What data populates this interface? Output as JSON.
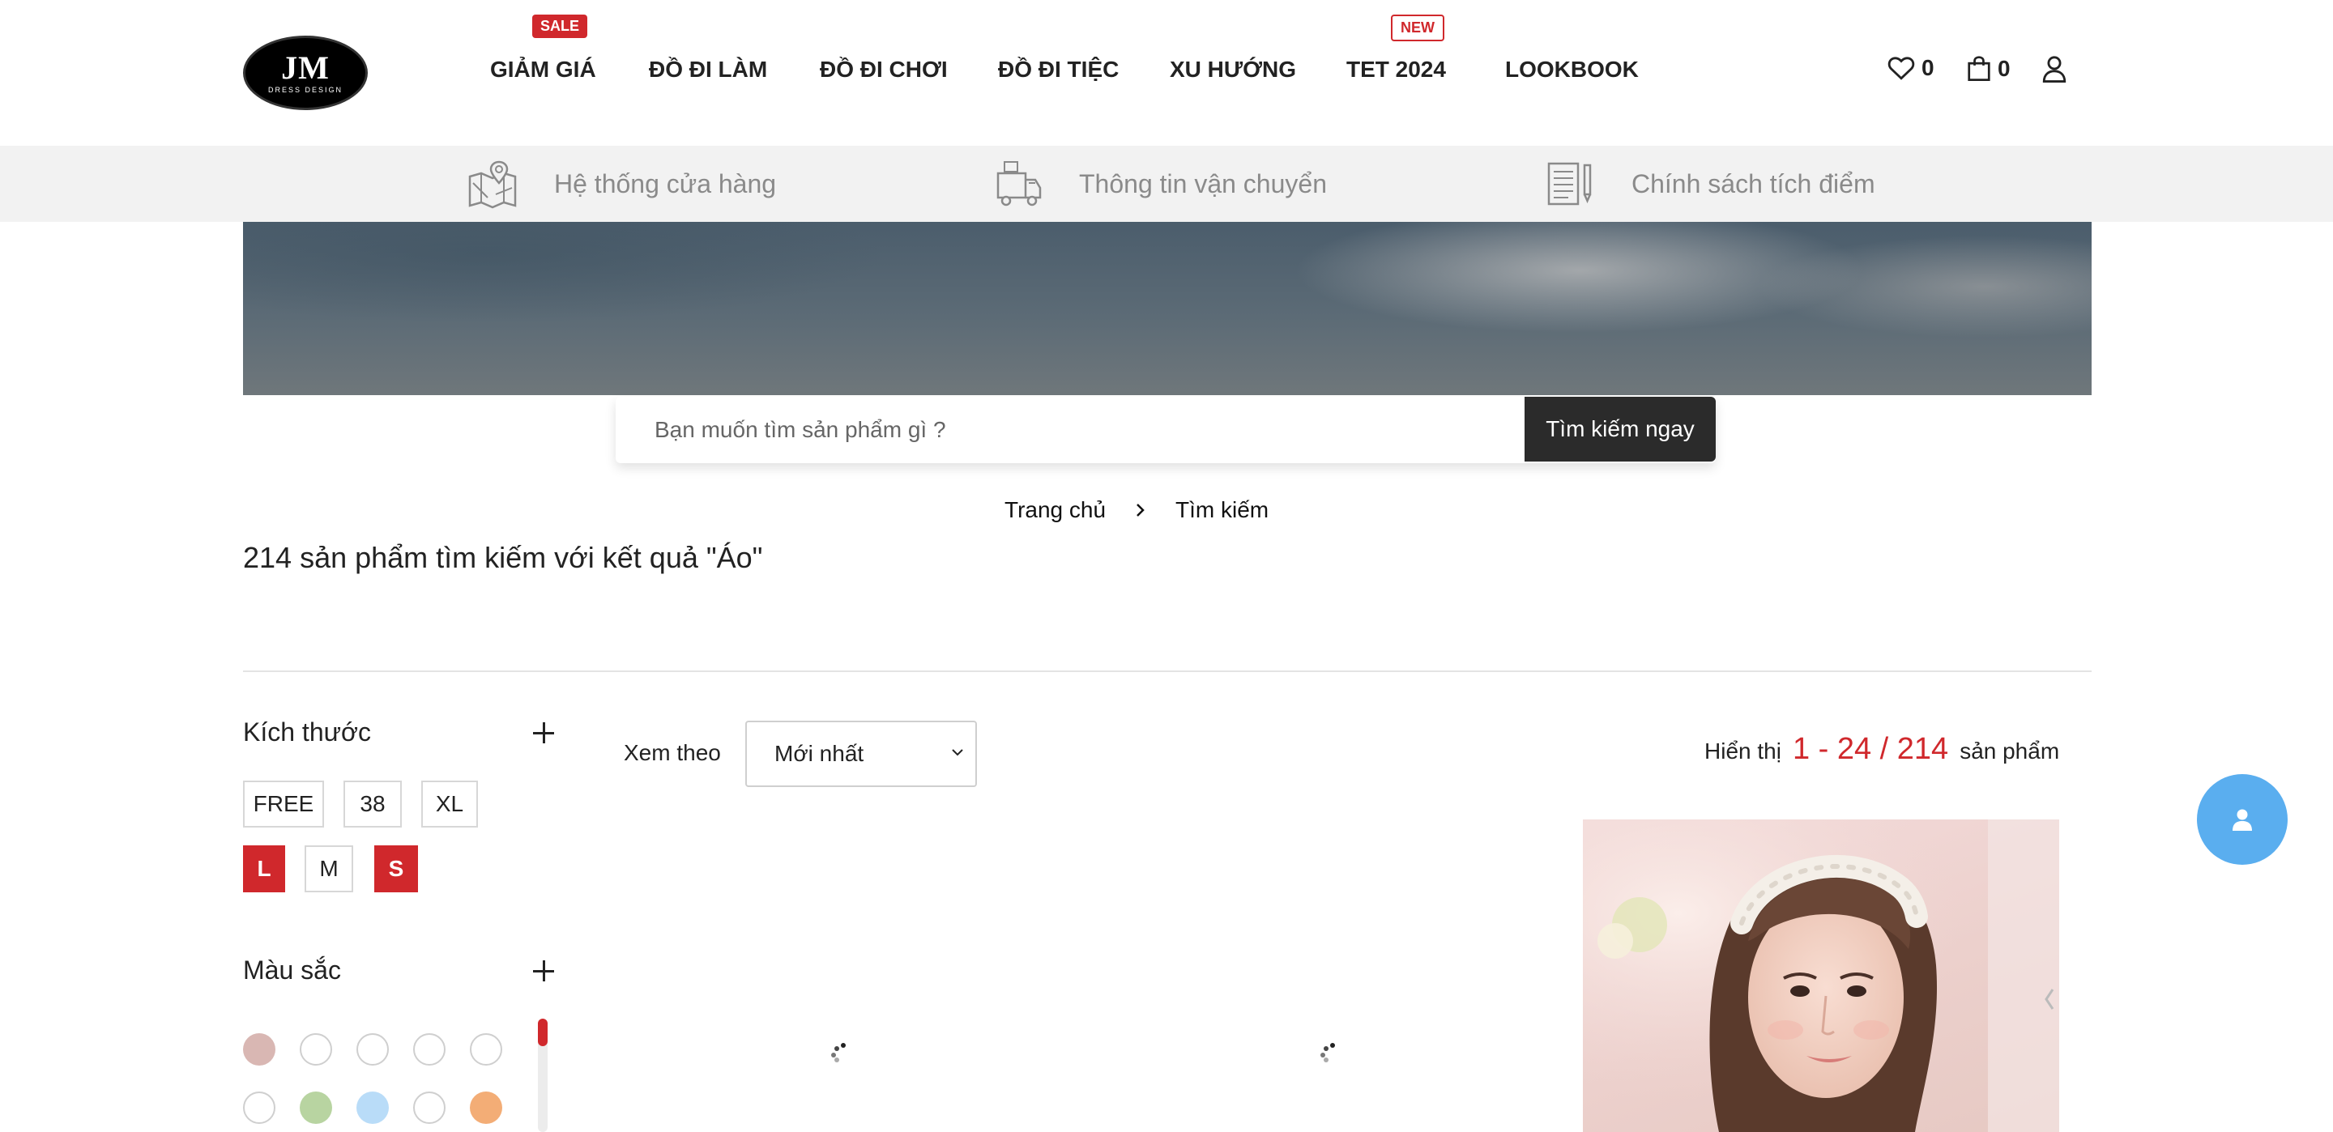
{
  "header": {
    "logo": {
      "main": "JM",
      "sub": "DRESS DESIGN"
    },
    "nav": [
      {
        "label": "GIẢM GIÁ",
        "badge": "SALE",
        "badge_type": "sale"
      },
      {
        "label": "ĐỒ ĐI LÀM"
      },
      {
        "label": "ĐỒ ĐI CHƠI"
      },
      {
        "label": "ĐỒ ĐI TIỆC"
      },
      {
        "label": "XU HƯỚNG"
      },
      {
        "label": "TET 2024",
        "badge": "NEW",
        "badge_type": "new"
      },
      {
        "label": "LOOKBOOK"
      }
    ],
    "wishlist_count": "0",
    "cart_count": "0"
  },
  "infobar": {
    "items": [
      {
        "label": "Hệ thống cửa hàng",
        "icon": "store-map-icon"
      },
      {
        "label": "Thông tin vận chuyển",
        "icon": "delivery-truck-icon"
      },
      {
        "label": "Chính sách tích điểm",
        "icon": "policy-document-icon"
      }
    ]
  },
  "search": {
    "placeholder": "Bạn muốn tìm sản phẩm gì ?",
    "value": "",
    "button_label": "Tìm kiếm ngay"
  },
  "breadcrumb": {
    "home": "Trang chủ",
    "current": "Tìm kiếm"
  },
  "results": {
    "title": "214 sản phẩm tìm kiếm với kết quả \"Áo\""
  },
  "filters": {
    "size": {
      "title": "Kích thước",
      "options": [
        {
          "label": "FREE",
          "active": false
        },
        {
          "label": "38",
          "active": false
        },
        {
          "label": "XL",
          "active": false
        },
        {
          "label": "L",
          "active": true
        },
        {
          "label": "M",
          "active": false
        },
        {
          "label": "S",
          "active": true
        }
      ]
    },
    "color": {
      "title": "Màu sắc",
      "swatches": [
        "#d9b7b3",
        "#ffffff",
        "#ffffff",
        "#ffffff",
        "#ffffff",
        "#ffffff",
        "#b8d4a1",
        "#b9dcf8",
        "#ffffff",
        "#f3ad76"
      ]
    }
  },
  "toolbar": {
    "sort_label": "Xem theo",
    "sort_value": "Mới nhất",
    "count_prefix": "Hiển thị",
    "count_range": "1 - 24 / 214",
    "count_suffix": "sản phẩm"
  },
  "colors": {
    "accent": "#d0282c",
    "dark_button": "#2b2b2b",
    "float_button": "#5aaeef"
  }
}
